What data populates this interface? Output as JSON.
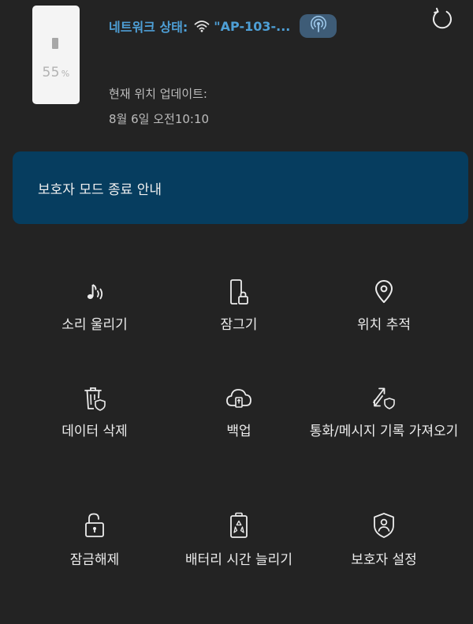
{
  "device": {
    "battery_value": "55",
    "battery_unit": "%"
  },
  "network": {
    "label": "네트워크 상태:",
    "ssid": "\"AP-103-...",
    "wifi_icon": "wifi-icon",
    "hotspot_icon": "hotspot-icon"
  },
  "refresh_icon": "refresh-icon",
  "location": {
    "label": "현재 위치 업데이트:",
    "time": "8월 6일 오전10:10"
  },
  "banner": {
    "text": "보호자 모드 종료 안내"
  },
  "actions": [
    {
      "label": "소리 울리기",
      "icon": "ring-sound-icon"
    },
    {
      "label": "잠그기",
      "icon": "lock-device-icon"
    },
    {
      "label": "위치 추적",
      "icon": "location-pin-icon"
    },
    {
      "label": "데이터 삭제",
      "icon": "delete-data-icon"
    },
    {
      "label": "백업",
      "icon": "cloud-backup-icon"
    },
    {
      "label": "통화/메시지 기록 가져오기",
      "icon": "call-log-icon"
    },
    {
      "label": "잠금해제",
      "icon": "unlock-icon"
    },
    {
      "label": "배터리 시간 늘리기",
      "icon": "battery-saver-icon"
    },
    {
      "label": "보호자 설정",
      "icon": "guardian-settings-icon"
    }
  ],
  "colors": {
    "background": "#232323",
    "accent": "#4e9fd6",
    "banner": "#063d5f",
    "hotspot_button": "#3e5c77"
  }
}
